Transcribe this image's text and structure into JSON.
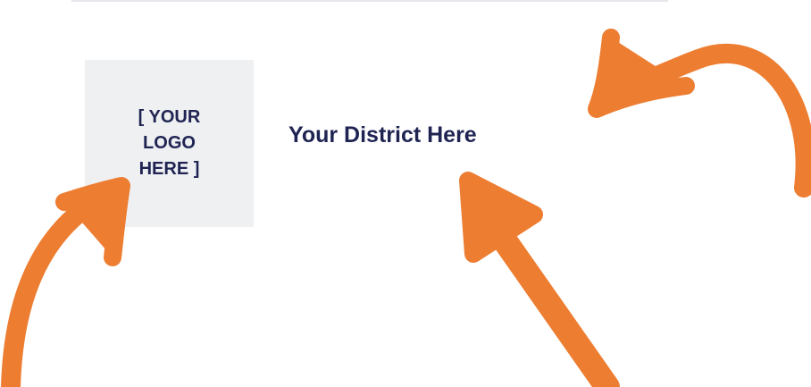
{
  "logo_placeholder": {
    "lines": [
      "[ YOUR",
      "LOGO",
      "HERE ]"
    ]
  },
  "district": {
    "title": "Your District Here"
  },
  "colors": {
    "accent_orange": "#ed7d31",
    "navy_text": "#1f2453",
    "logo_background": "#eff0f2"
  },
  "icons": [
    "curved-arrow-icon",
    "curved-arrow-icon",
    "straight-arrow-icon"
  ]
}
